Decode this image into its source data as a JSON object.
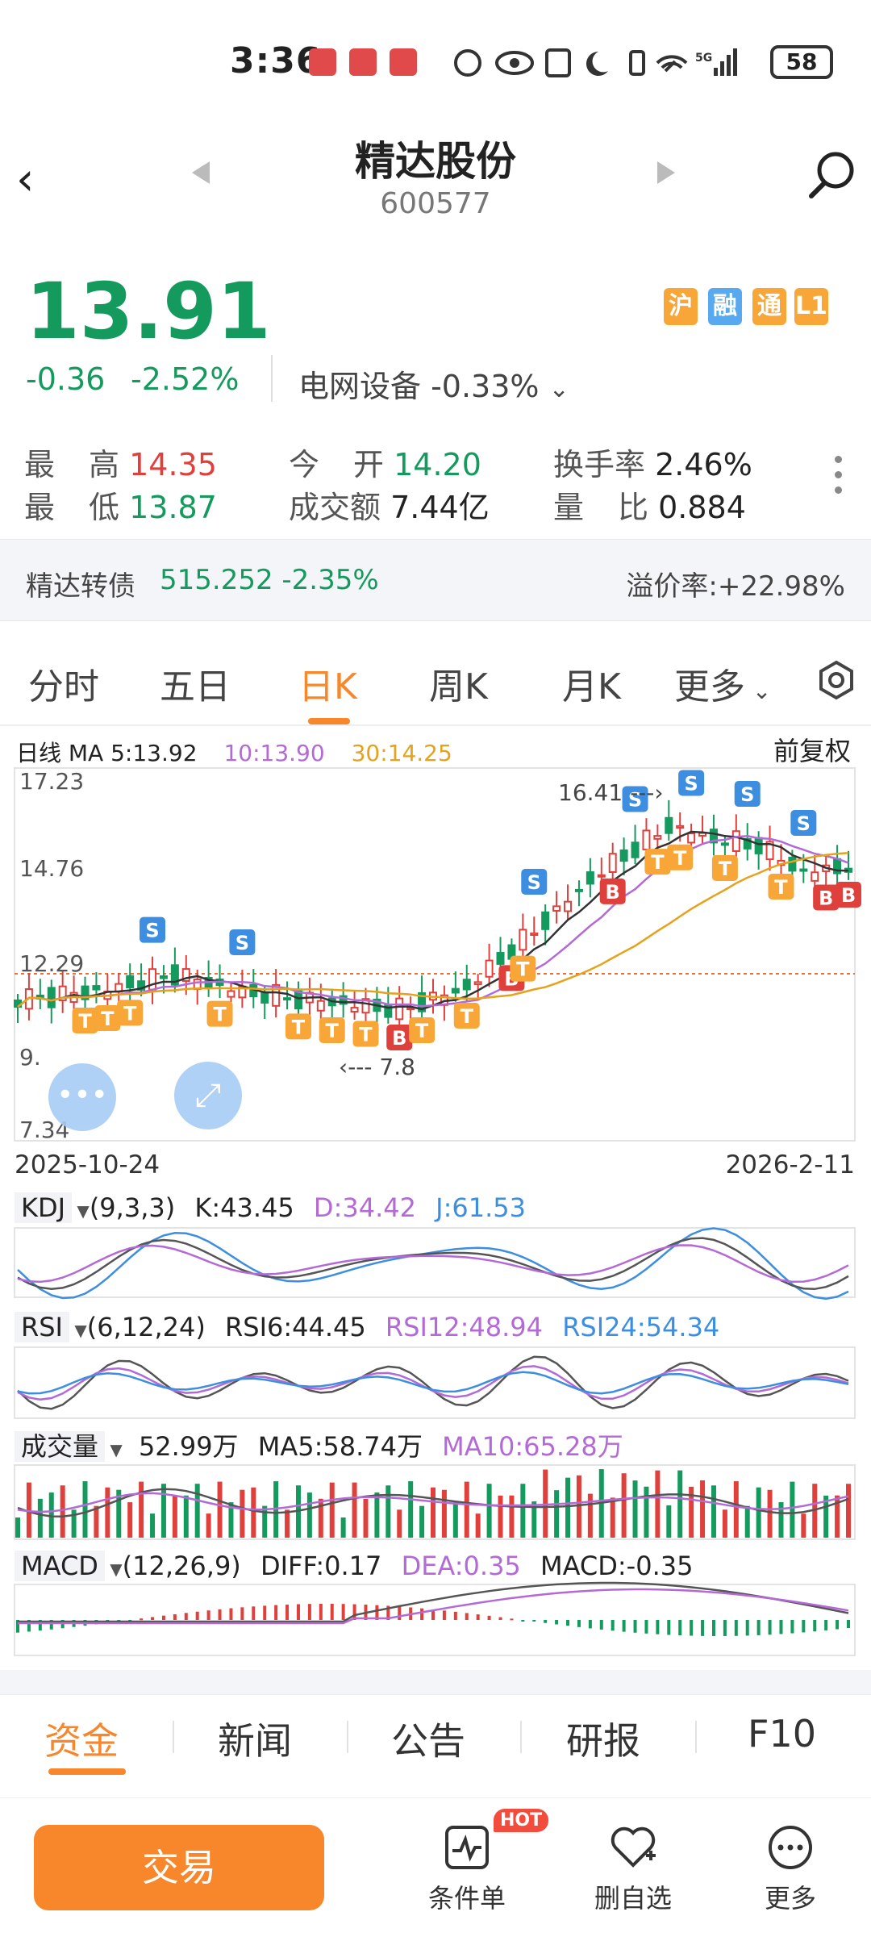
{
  "status_bar": {
    "time": "3:36",
    "battery": "58",
    "network": "5G"
  },
  "header": {
    "stock_name": "精达股份",
    "stock_code": "600577"
  },
  "quote": {
    "price": "13.91",
    "change": "-0.36",
    "change_pct": "-2.52%",
    "sector": "电网设备 -0.33%",
    "badges": [
      "沪",
      "融",
      "通",
      "L1"
    ],
    "high_label_a": "最",
    "high_label_b": "高",
    "high": "14.35",
    "low_label_a": "最",
    "low_label_b": "低",
    "low": "13.87",
    "open_label_a": "今",
    "open_label_b": "开",
    "open": "14.20",
    "turnover_amt_label": "成交额",
    "turnover_amt": "7.44亿",
    "turnover_rate_label": "换手率",
    "turnover_rate": "2.46%",
    "vol_ratio_label_a": "量",
    "vol_ratio_label_b": "比",
    "vol_ratio": "0.884"
  },
  "bond": {
    "name": "精达转债",
    "value": "515.252 -2.35%",
    "premium": "溢价率:+22.98%"
  },
  "tabs": [
    "分时",
    "五日",
    "日K",
    "周K",
    "月K",
    "更多"
  ],
  "active_tab": "日K",
  "chart": {
    "ma_label": "日线 MA 5:13.92",
    "ma10": "10:13.90",
    "ma30": "30:14.25",
    "adjust": "前复权",
    "y_labels": [
      "17.23",
      "14.76",
      "12.29",
      "9.",
      "7.34"
    ],
    "peak_annotation": "16.41",
    "low_annotation": "7.8",
    "date_start": "2025-10-24",
    "date_end": "2026-2-11"
  },
  "kdj": {
    "name": "KDJ",
    "params": "(9,3,3)",
    "k": "K:43.45",
    "d": "D:34.42",
    "j": "J:61.53"
  },
  "rsi": {
    "name": "RSI",
    "params": "(6,12,24)",
    "r6": "RSI6:44.45",
    "r12": "RSI12:48.94",
    "r24": "RSI24:54.34"
  },
  "vol": {
    "name": "成交量",
    "value": "52.99万",
    "ma5": "MA5:58.74万",
    "ma10": "MA10:65.28万"
  },
  "macd": {
    "name": "MACD",
    "params": "(12,26,9)",
    "diff": "DIFF:0.17",
    "dea": "DEA:0.35",
    "macd": "MACD:-0.35"
  },
  "bottom_tabs": [
    "资金",
    "新闻",
    "公告",
    "研报",
    "F10"
  ],
  "bottom_bar": {
    "trade": "交易",
    "cond": "条件单",
    "hot": "HOT",
    "fav": "删自选",
    "more": "更多"
  },
  "colors": {
    "up": "#e0403c",
    "down": "#159a5e",
    "accent": "#f7872a",
    "ma5": "#333333",
    "ma10": "#b46ad6",
    "ma30": "#e6a21c"
  }
}
